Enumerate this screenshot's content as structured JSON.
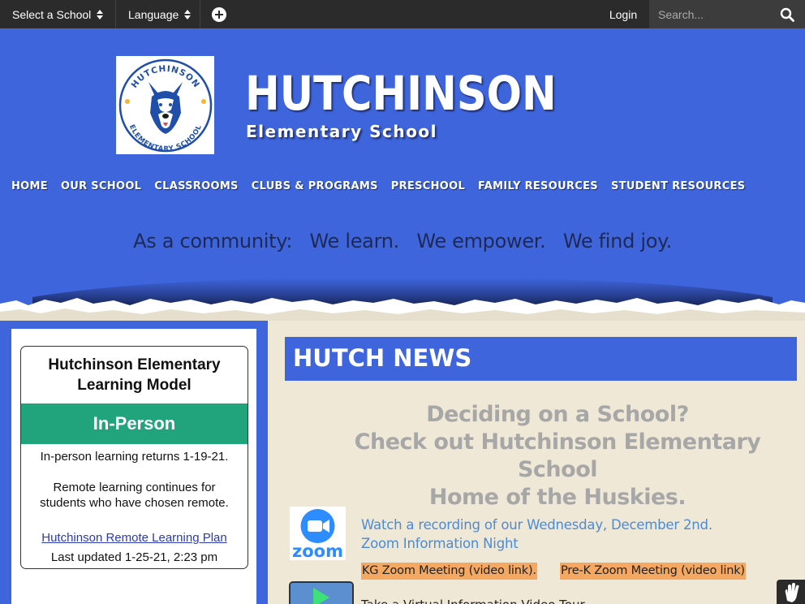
{
  "topbar": {
    "select_school": "Select a School",
    "language": "Language",
    "login": "Login",
    "search_placeholder": "Search..."
  },
  "header": {
    "title": "HUTCHINSON",
    "subtitle": "Elementary School",
    "logo_text_top": "HUTCHINSON",
    "logo_text_bottom": "ELEMENTARY SCHOOL"
  },
  "nav": {
    "items": [
      "HOME",
      "OUR SCHOOL",
      "CLASSROOMS",
      "CLUBS & PROGRAMS",
      "PRESCHOOL",
      "FAMILY RESOURCES",
      "STUDENT RESOURCES"
    ]
  },
  "motto": {
    "part1": "As a community:",
    "part2": "We learn.",
    "part3": "We empower.",
    "part4": "We find joy."
  },
  "sidebar": {
    "card_title_line1": "Hutchinson Elementary",
    "card_title_line2": "Learning Model",
    "status": "In-Person",
    "status_color": "#21a37b",
    "line1": "In-person learning returns 1-19-21.",
    "line2": "Remote learning continues for",
    "line3": "students who have chosen remote.",
    "link": "Hutchinson Remote Learning Plan",
    "updated": "Last updated 1-25-21, 2:23 pm"
  },
  "news": {
    "heading": "HUTCH NEWS",
    "promo_line1": "Deciding on a School?",
    "promo_line2": "Check out Hutchinson Elementary School",
    "promo_line3": "Home of the Huskies.",
    "zoom_logo_text": "zoom",
    "zoom_line1": "Watch a recording of our Wednesday, December 2nd.",
    "zoom_line2": "Zoom Information Night",
    "kg_link": "KG Zoom Meeting (video link).",
    "prek_link": "Pre-K Zoom Meeting (video link)",
    "cut_text": "Take a Virtual Information Video Tour"
  },
  "colors": {
    "brand_blue": "#3f65dc",
    "topbar": "#2b2b2b",
    "link_highlight": "#f4a861",
    "content_bg": "#f0e8d6"
  }
}
